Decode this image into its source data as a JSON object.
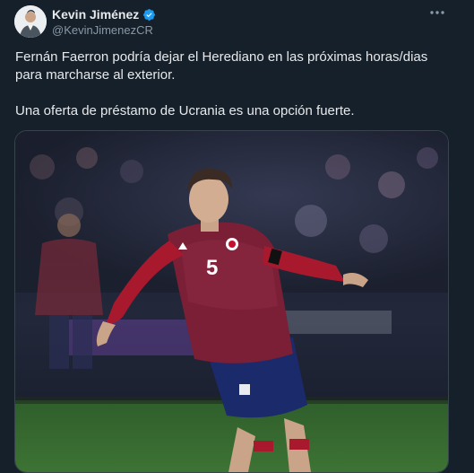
{
  "tweet": {
    "author_name": "Kevin Jiménez",
    "author_handle": "@KevinJimenezCR",
    "more_icon": "more-horizontal-icon",
    "verified_icon": "verified-badge-icon",
    "text_line_1": "Fernán Faerron podría dejar el Herediano en las próximas horas/dias para marcharse al exterior.",
    "text_line_2": "Una oferta de préstamo de Ucrania es una opción fuerte.",
    "media": {
      "shirt_number": "5"
    }
  },
  "colors": {
    "background": "#15202b",
    "verified": "#1d9bf0",
    "text": "#e7e9ea",
    "muted": "#8b98a5"
  }
}
